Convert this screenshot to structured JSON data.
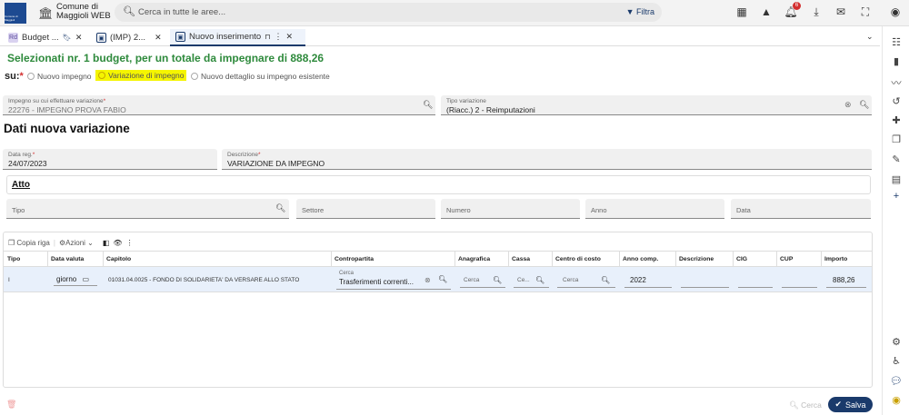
{
  "header": {
    "logo_text": "Comune di Maggioli",
    "ente_name": "Comune di Maggioli WEB",
    "search_placeholder": "Cerca in tutte le aree...",
    "filter_label": "Filtra",
    "notif_count": "6"
  },
  "tabs": [
    {
      "label": "Budget ...",
      "icon_text": "Rd",
      "icon_color": "#8e7cc3"
    },
    {
      "label": "(IMP) 2...",
      "icon_text": "▣",
      "icon_color": "#1a3a6b"
    },
    {
      "label": "Nuovo inserimento",
      "icon_text": "▣",
      "icon_color": "#1a3a6b"
    }
  ],
  "page": {
    "title": "Selezionati nr. 1 budget, per un totale da impegnare di 888,26",
    "su_label": "su:",
    "su_req": "*",
    "radios": [
      "Nuovo impegno",
      "Variazione di impegno",
      "Nuovo dettaglio su impegno esistente"
    ],
    "impegno": {
      "label": "Impegno su cui effettuare variazione",
      "value": "22276 - IMPEGNO PROVA FABIO"
    },
    "tipo_variazione": {
      "label": "Tipo variazione",
      "value": "(Riacc.) 2 - Reimputazioni"
    },
    "section_title": "Dati nuova variazione",
    "data_reg": {
      "label": "Data reg.",
      "value": "24/07/2023"
    },
    "descrizione": {
      "label": "Descrizione",
      "value": "VARIAZIONE DA IMPEGNO"
    },
    "atto": {
      "title": "Atto",
      "tipo": "Tipo",
      "settore": "Settore",
      "numero": "Numero",
      "anno": "Anno",
      "data": "Data"
    }
  },
  "grid": {
    "toolbar": {
      "copia": "Copia riga",
      "azioni": "Azioni"
    },
    "columns": [
      "Tipo",
      "Data valuta",
      "Capitolo",
      "Contropartita",
      "Anagrafica",
      "Cassa",
      "Centro di costo",
      "Anno comp.",
      "Descrizione",
      "CIG",
      "CUP",
      "Importo"
    ],
    "row": {
      "tipo": "I",
      "data_valuta": "giorno",
      "capitolo": "01031.04.0025 - FONDO DI SOLIDARIETA' DA VERSARE ALLO STATO",
      "contropartita_label": "Cerca",
      "contropartita_value": "Trasferimenti correnti...",
      "anagrafica": "Cerca",
      "cassa": "Ce...",
      "centro": "Cerca",
      "anno": "2022",
      "importo": "888,26"
    }
  },
  "footer": {
    "cerca": "Cerca",
    "salva": "Salva"
  }
}
